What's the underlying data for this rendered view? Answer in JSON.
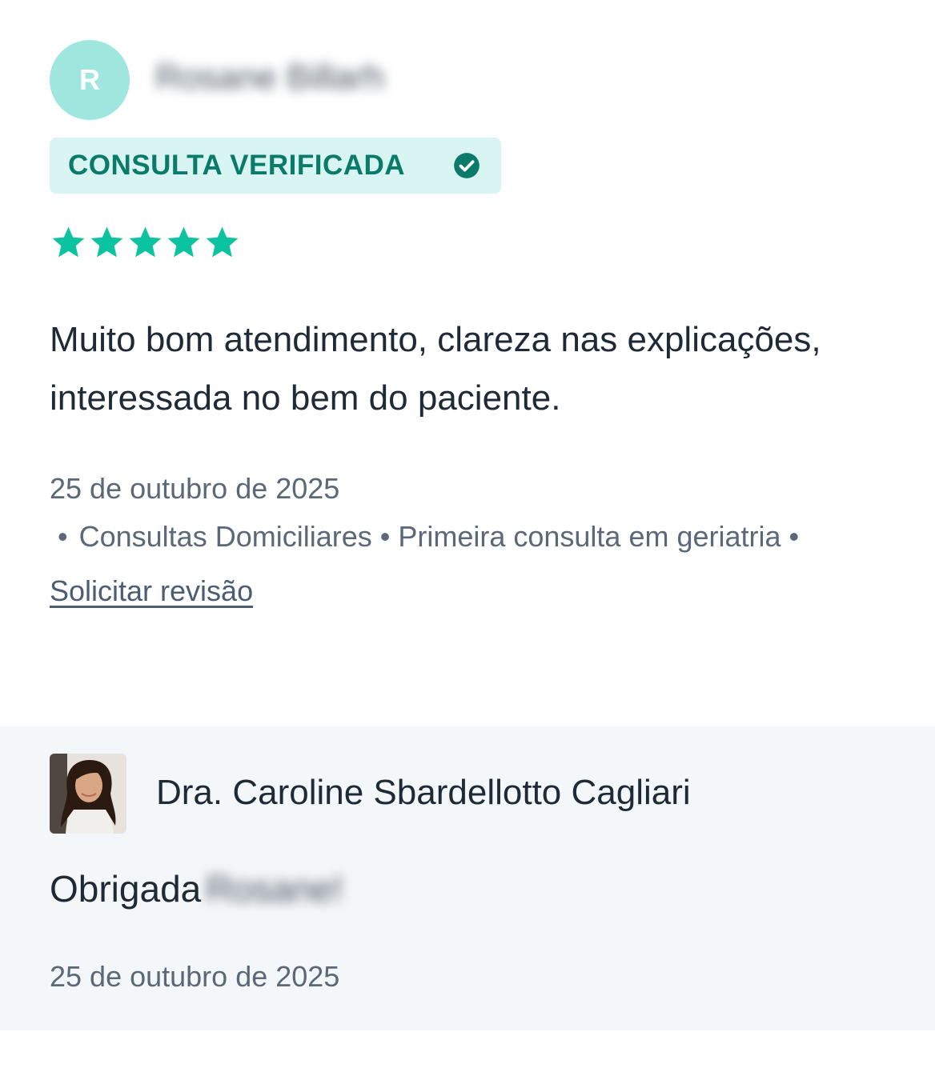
{
  "review": {
    "avatar_initial": "R",
    "reviewer_name": "Rosane Billarh",
    "badge_label": "CONSULTA VERIFICADA",
    "rating": 5,
    "rating_max": 5,
    "text": "Muito bom atendimento, clareza nas explicações, interessada no bem do paciente.",
    "date": "25 de outubro de 2025",
    "services": [
      "Consultas Domiciliares",
      "Primeira consulta em geriatria"
    ],
    "separator": "•",
    "request_review_link": "Solicitar revisão",
    "colors": {
      "avatar_bg": "#9fe6de",
      "badge_bg": "#d8f5f3",
      "badge_text": "#0a7a69",
      "star": "#0bc3a0"
    }
  },
  "reply": {
    "doctor_name": "Dra. Caroline Sbardellotto Cagliari",
    "text_prefix": "Obrigada",
    "text_blurred_name": "Rosane!",
    "date": "25 de outubro de 2025",
    "colors": {
      "background": "#f4f7f9"
    }
  }
}
